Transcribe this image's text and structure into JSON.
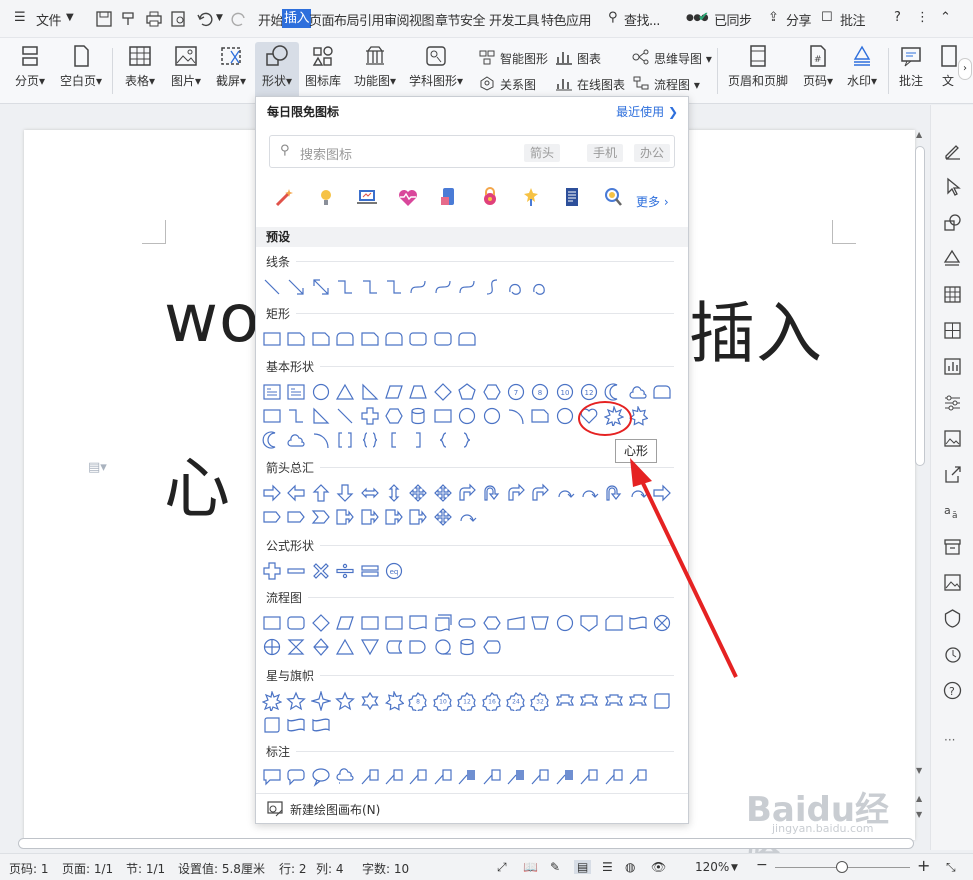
{
  "menu": {
    "file": "文件",
    "tabs": [
      "开始",
      "插入",
      "页面布局",
      "引用",
      "审阅",
      "视图",
      "章节",
      "安全",
      "开发工具",
      "特色应用"
    ],
    "active_tab": "插入",
    "search": "查找...",
    "sync": "已同步",
    "share": "分享",
    "comment": "批注",
    "help": "?"
  },
  "ribbon": {
    "page_break": "分页",
    "blank_page": "空白页",
    "table": "表格",
    "picture": "图片",
    "screenshot": "截屏",
    "shape": "形状",
    "icon_lib": "图标库",
    "func_chart": "功能图",
    "smart_shape": "智能图形",
    "chart": "图表",
    "mind_map": "思维导图",
    "subject_shape": "学科图形",
    "relation": "关系图",
    "online_chart": "在线图表",
    "flowchart": "流程图",
    "header_footer": "页眉和页脚",
    "page_num": "页码",
    "watermark": "水印",
    "annotation": "批注",
    "text_cut": "文"
  },
  "document": {
    "line1_left": "wo",
    "line1_right": "插入",
    "line2": "心"
  },
  "popup": {
    "title": "每日限免图标",
    "recent": "最近使用",
    "search_placeholder": "搜索图标",
    "tags": [
      "箭头",
      "手机",
      "办公"
    ],
    "more": "更多",
    "preset": "预设",
    "categories": [
      "线条",
      "矩形",
      "基本形状",
      "箭头总汇",
      "公式形状",
      "流程图",
      "星与旗帜",
      "标注"
    ],
    "tooltip": "心形",
    "new_canvas": "新建绘图画布(N)"
  },
  "status": {
    "page_num": "页码: 1",
    "pages": "页面: 1/1",
    "section": "节: 1/1",
    "setting": "设置值: 5.8厘米",
    "row": "行: 2",
    "col": "列: 4",
    "words": "字数: 10",
    "zoom": "120%"
  },
  "colors": {
    "accent": "#2e6fdc",
    "shape_stroke": "#4b73c5",
    "highlight": "#e52222"
  },
  "watermark": {
    "brand": "Baidu经验",
    "url": "jingyan.baidu.com"
  }
}
